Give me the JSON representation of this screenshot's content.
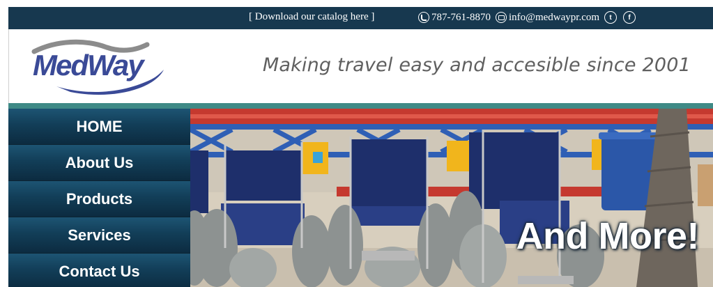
{
  "topbar": {
    "catalog_link": "[ Download our catalog here ]",
    "phone": "787-761-8870",
    "email": "info@medwaypr.com",
    "icons": [
      "phone-icon",
      "mail-icon",
      "twitter-icon",
      "facebook-icon"
    ]
  },
  "header": {
    "logo_text": "MedWay",
    "tagline": "Making travel easy and accesible since 2001"
  },
  "nav": {
    "items": [
      {
        "label": "HOME"
      },
      {
        "label": "About Us"
      },
      {
        "label": "Products"
      },
      {
        "label": "Services"
      },
      {
        "label": "Contact Us"
      }
    ]
  },
  "hero": {
    "caption": "And More!"
  },
  "colors": {
    "topbar": "#17384f",
    "nav": "#123e58",
    "accent_teal": "#3f8a86",
    "logo_blue": "#3a4a97",
    "tagline_gray": "#5f5f5f"
  }
}
